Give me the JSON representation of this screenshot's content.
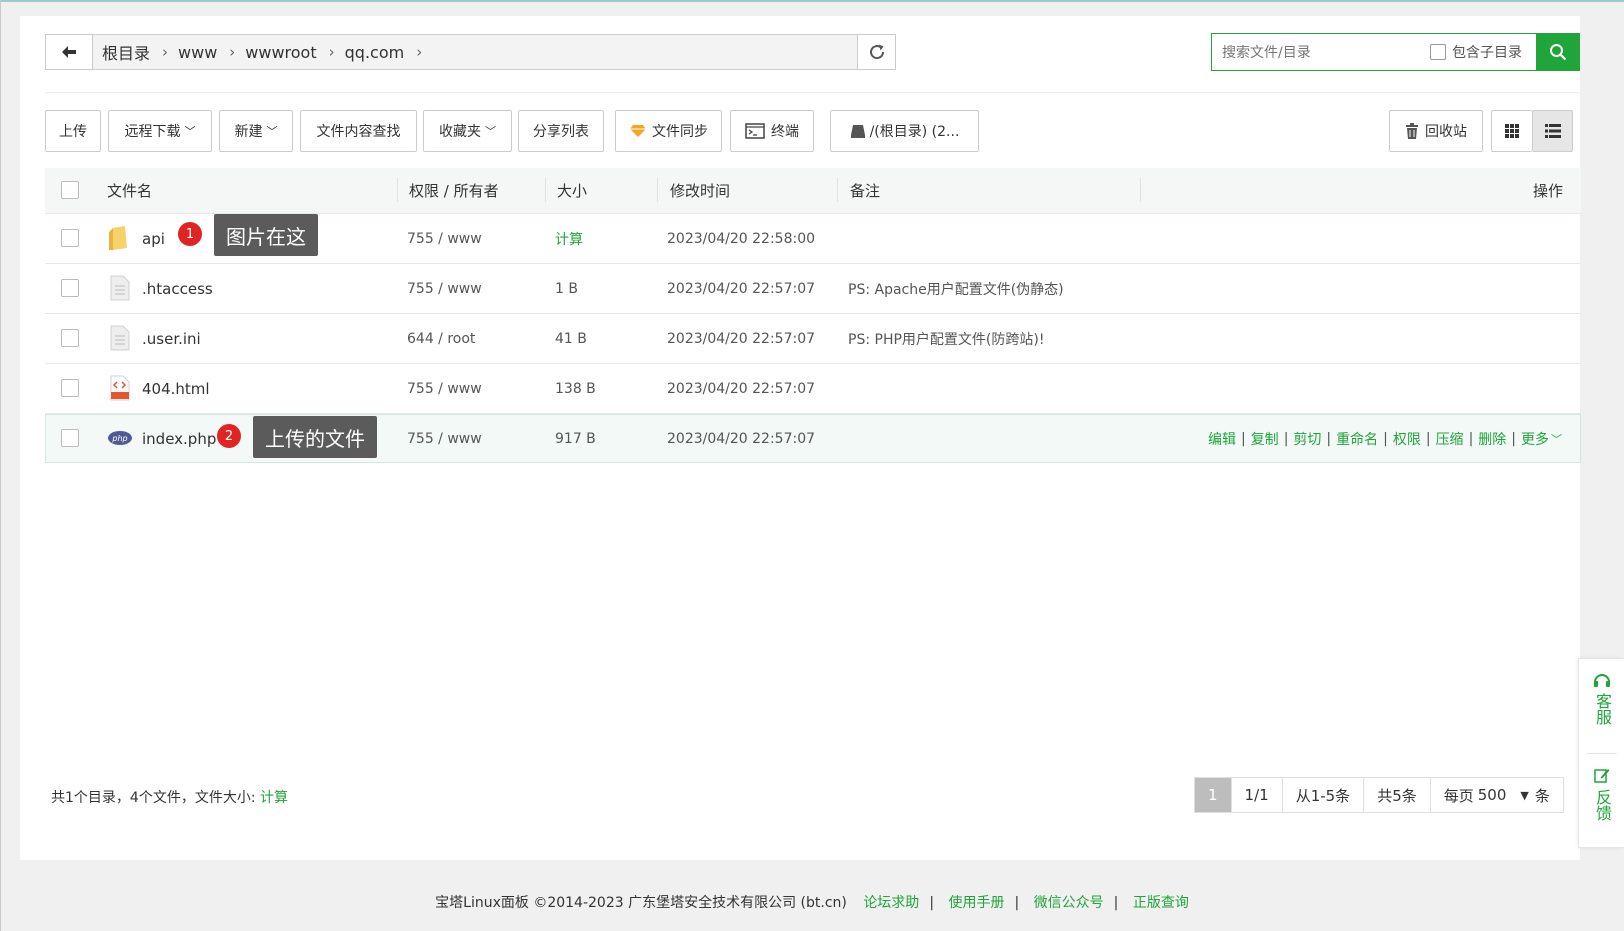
{
  "breadcrumb": {
    "items": [
      "根目录",
      "www",
      "wwwroot",
      "qq.com"
    ]
  },
  "search": {
    "placeholder": "搜索文件/目录",
    "include_subdir_label": "包含子目录"
  },
  "toolbar": {
    "upload": "上传",
    "remote_download": "远程下载",
    "new": "新建",
    "content_search": "文件内容查找",
    "favorites": "收藏夹",
    "share_list": "分享列表",
    "file_sync": "文件同步",
    "terminal": "终端",
    "disk": "/(根目录) (2...",
    "recycle_bin": "回收站"
  },
  "table": {
    "headers": {
      "name": "文件名",
      "permission": "权限 / 所有者",
      "size": "大小",
      "mtime": "修改时间",
      "note": "备注",
      "actions": "操作"
    },
    "rows": [
      {
        "name": "api",
        "icon": "folder-icon",
        "perm": "755 / www",
        "size": "计算",
        "mtime": "2023/04/20 22:58:00",
        "note": ""
      },
      {
        "name": ".htaccess",
        "icon": "file-icon",
        "perm": "755 / www",
        "size": "1 B",
        "mtime": "2023/04/20 22:57:07",
        "note": "PS: Apache用户配置文件(伪静态)"
      },
      {
        "name": ".user.ini",
        "icon": "file-icon",
        "perm": "644 / root",
        "size": "41 B",
        "mtime": "2023/04/20 22:57:07",
        "note": "PS: PHP用户配置文件(防跨站)!"
      },
      {
        "name": "404.html",
        "icon": "html-file-icon",
        "perm": "755 / www",
        "size": "138 B",
        "mtime": "2023/04/20 22:57:07",
        "note": ""
      },
      {
        "name": "index.php",
        "icon": "php-file-icon",
        "perm": "755 / www",
        "size": "917 B",
        "mtime": "2023/04/20 22:57:07",
        "note": ""
      }
    ],
    "row_actions": [
      "编辑",
      "复制",
      "剪切",
      "重命名",
      "权限",
      "压缩",
      "删除",
      "更多"
    ]
  },
  "annotations": [
    {
      "number": "1",
      "text": "图片在这"
    },
    {
      "number": "2",
      "text": "上传的文件"
    }
  ],
  "summary": {
    "text": "共1个目录，4个文件，文件大小:",
    "calc_link": "计算"
  },
  "pagination": {
    "current_page": "1",
    "pages": "1/1",
    "range": "从1-5条",
    "total": "共5条",
    "per_page_label": "每页",
    "per_page_value": "500",
    "unit": "条"
  },
  "side_widget": {
    "service": "客服",
    "feedback": "反馈"
  },
  "footer": {
    "copyright": "宝塔Linux面板 ©2014-2023 广东堡塔安全技术有限公司 (bt.cn)",
    "links": [
      "论坛求助",
      "使用手册",
      "微信公众号",
      "正版查询"
    ]
  },
  "colors": {
    "accent": "#20a53a",
    "badge": "#e02424",
    "tooltip": "#5b5b5b"
  }
}
